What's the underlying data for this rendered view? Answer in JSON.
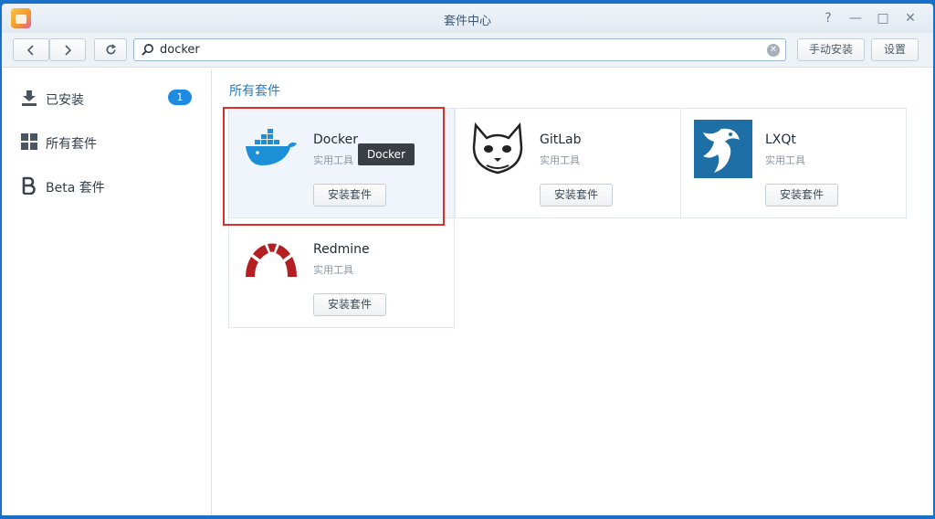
{
  "window": {
    "title": "套件中心",
    "controls": {
      "help": "?",
      "minimize": "—",
      "maximize": "□",
      "close": "✕"
    }
  },
  "toolbar": {
    "back_icon": "chevron-left-icon",
    "forward_icon": "chevron-right-icon",
    "refresh_icon": "refresh-icon",
    "search_value": "docker",
    "manual_install_label": "手动安装",
    "settings_label": "设置"
  },
  "sidebar": {
    "items": [
      {
        "label": "已安装",
        "icon": "download-icon",
        "badge": "1"
      },
      {
        "label": "所有套件",
        "icon": "grid-icon"
      },
      {
        "label": "Beta 套件",
        "icon": "beta-icon"
      }
    ]
  },
  "main": {
    "section_title": "所有套件",
    "packages": [
      {
        "name": "Docker",
        "category": "实用工具",
        "button": "安装套件",
        "logo": "docker-logo"
      },
      {
        "name": "GitLab",
        "category": "实用工具",
        "button": "安装套件",
        "logo": "gitlab-logo"
      },
      {
        "name": "LXQt",
        "category": "实用工具",
        "button": "安装套件",
        "logo": "lxqt-logo"
      },
      {
        "name": "Redmine",
        "category": "实用工具",
        "button": "安装套件",
        "logo": "redmine-logo"
      }
    ],
    "tooltip": "Docker"
  },
  "colors": {
    "accent": "#1e7ec8",
    "badge": "#1f8ae2",
    "highlight": "#d9302b",
    "docker": "#1d8fd6",
    "lxqt": "#1d6fa5",
    "redmine": "#b41f24"
  }
}
